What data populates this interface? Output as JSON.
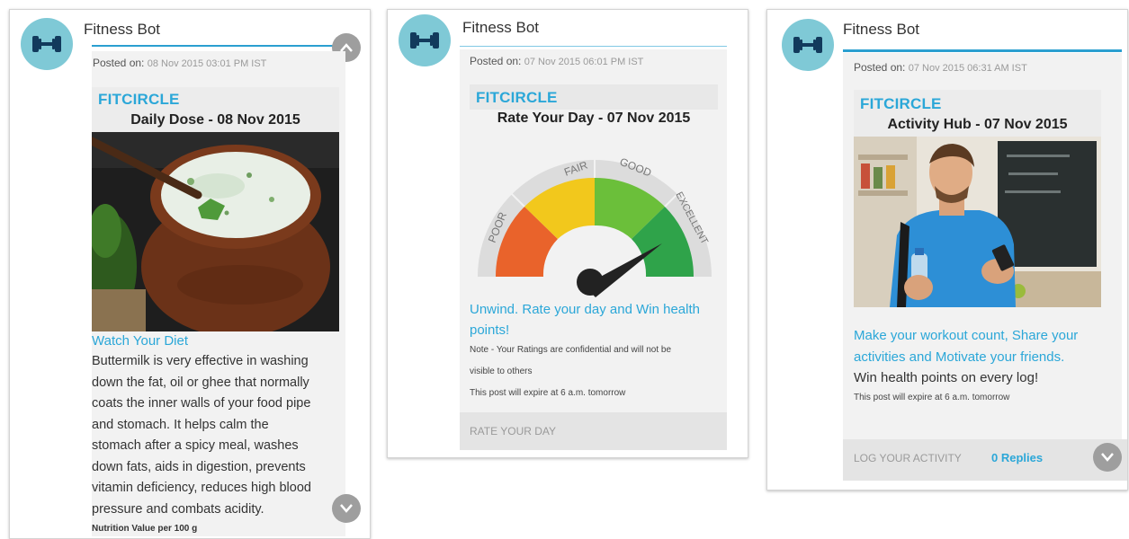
{
  "card1": {
    "bot_name": "Fitness Bot",
    "posted_label": "Posted on:",
    "posted_date": "08 Nov 2015 03:01 PM IST",
    "brand": "FITCIRCLE",
    "title": "Daily Dose - 08 Nov 2015",
    "link_text": "Watch Your Diet",
    "body_lines": [
      "Buttermilk is very effective in washing",
      "down the fat, oil or ghee that normally",
      "coats the inner walls of your food pipe",
      "and stomach. It helps calm the",
      "stomach after a spicy meal, washes",
      "down fats, aids in digestion, prevents",
      "vitamin deficiency, reduces high blood",
      "pressure and combats acidity."
    ],
    "cutoff_text": "Nutrition Value per 100 g",
    "image_icon": "buttermilk-pot-photo"
  },
  "card2": {
    "bot_name": "Fitness Bot",
    "posted_label": "Posted on:",
    "posted_date": "07 Nov 2015 06:01 PM IST",
    "brand": "FITCIRCLE",
    "title": "Rate Your Day - 07 Nov 2015",
    "gauge_labels": [
      "POOR",
      "FAIR",
      "GOOD",
      "EXCELLENT"
    ],
    "gauge_colors": [
      "#e9632b",
      "#f2c81c",
      "#6bbf3a",
      "#2fa34a"
    ],
    "link_line1": "Unwind. Rate your day and Win health",
    "link_line2": "points!",
    "note_line1": "Note - Your Ratings are confidential and will not be",
    "note_line2": "visible to others",
    "expire": "This post will expire at 6 a.m. tomorrow",
    "action": "RATE YOUR DAY"
  },
  "card3": {
    "bot_name": "Fitness Bot",
    "posted_label": "Posted on:",
    "posted_date": "07 Nov 2015 06:31 AM IST",
    "brand": "FITCIRCLE",
    "title": "Activity Hub - 07 Nov 2015",
    "link_line1": "Make your workout count, Share your",
    "link_line2": "activities and Motivate your friends.",
    "body": "Win health points on every log!",
    "expire": "This post will expire at 6 a.m. tomorrow",
    "action": "LOG YOUR ACTIVITY",
    "replies": "0 Replies",
    "image_icon": "man-with-phone-photo"
  },
  "colors": {
    "accent": "#2ba7d8",
    "avatar_bg": "#7fc9d6",
    "panel": "#f2f2f2",
    "button_gray": "#9e9e9e"
  }
}
